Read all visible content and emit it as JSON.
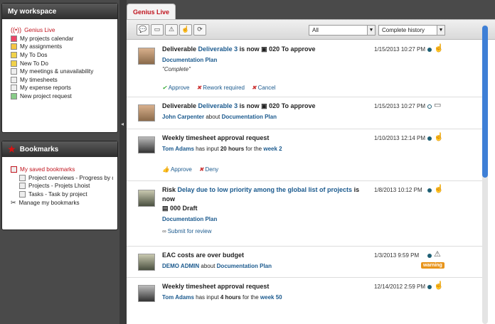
{
  "workspace": {
    "title": "My workspace",
    "items": [
      {
        "icon": "broadcast-icon",
        "label": "Genius Live",
        "active": true
      },
      {
        "icon": "calendar-icon",
        "label": "My projects calendar"
      },
      {
        "icon": "assignment-icon",
        "label": "My assignments"
      },
      {
        "icon": "todo-icon",
        "label": "My To Dos"
      },
      {
        "icon": "new-todo-icon",
        "label": "New To Do"
      },
      {
        "icon": "meeting-icon",
        "label": "My meetings & unavailability"
      },
      {
        "icon": "timesheet-icon",
        "label": "My timesheets"
      },
      {
        "icon": "expense-icon",
        "label": "My expense reports"
      },
      {
        "icon": "project-request-icon",
        "label": "New project request"
      }
    ]
  },
  "bookmarks": {
    "title": "Bookmarks",
    "saved_label": "My saved bookmarks",
    "items": [
      "Project overviews - Progress by deli",
      "Projects - Projets Lhoist",
      "Tasks - Task by project"
    ],
    "manage_label": "Manage my bookmarks"
  },
  "tab": {
    "label": "Genius Live"
  },
  "toolbar": {
    "filter_value": "All",
    "history_value": "Complete history"
  },
  "feed": [
    {
      "avatar": "avatar-1",
      "prefix": "Deliverable",
      "link": "Deliverable 3",
      "mid": "is now",
      "state": "020 To approve",
      "line2_link": "Documentation Plan",
      "quote": "\"Complete\"",
      "date": "1/15/2013 10:27 PM",
      "actions": [
        "Approve",
        "Rework required",
        "Cancel"
      ]
    },
    {
      "avatar": "avatar-1",
      "prefix": "Deliverable",
      "link": "Deliverable 3",
      "mid": "is now",
      "state": "020 To approve",
      "line2_user": "John Carpenter",
      "line2_mid": "about",
      "line2_link": "Documentation Plan",
      "date": "1/15/2013 10:27 PM"
    },
    {
      "avatar": "avatar-2",
      "title": "Weekly timesheet approval request",
      "line2_user": "Tom Adams",
      "line2_mid": "has input",
      "line2_bold": "20 hours",
      "line2_mid2": "for the",
      "line2_link": "week 2",
      "date": "1/10/2013 12:14 PM",
      "actions": [
        "Approve",
        "Deny"
      ]
    },
    {
      "avatar": "avatar-3",
      "prefix": "Risk",
      "link": "Delay due to low priority among the global list of projects",
      "mid": "is now",
      "state": "000 Draft",
      "line2_link": "Documentation Plan",
      "date": "1/8/2013 10:12 PM",
      "actions": [
        "Submit for review"
      ]
    },
    {
      "avatar": "avatar-4",
      "title": "EAC costs are over budget",
      "line2_user": "DEMO ADMIN",
      "line2_mid": "about",
      "line2_link": "Documentation Plan",
      "date": "1/3/2013 9:59 PM",
      "badge": "warning"
    },
    {
      "avatar": "avatar-2",
      "title": "Weekly timesheet approval request",
      "line2_user": "Tom Adams",
      "line2_mid": "has input",
      "line2_bold": "4 hours",
      "line2_mid2": "for the",
      "line2_link": "week 50",
      "date": "12/14/2012 2:59 PM"
    }
  ],
  "colors": {
    "accent": "#c0141e",
    "link": "#1b5a8e",
    "warning": "#e8941a",
    "scroll": "#3e7fd6"
  }
}
